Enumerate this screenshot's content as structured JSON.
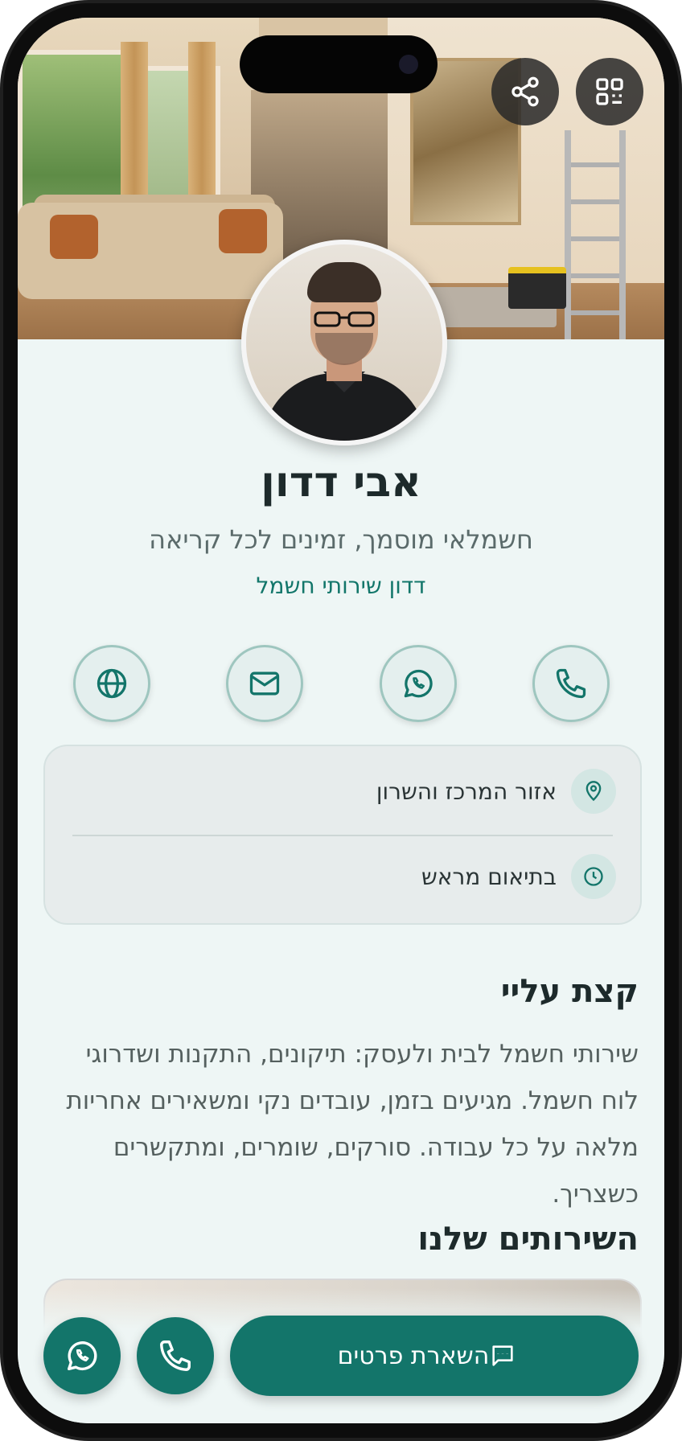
{
  "profile": {
    "name": "אבי דדון",
    "title": "חשמלאי מוסמך, זמינים לכל קריאה",
    "company": "דדון שירותי חשמל"
  },
  "info": {
    "area": "אזור המרכז והשרון",
    "hours": "בתיאום מראש"
  },
  "about": {
    "heading": "קצת עליי",
    "text": "שירותי חשמל לבית ולעסק: תיקונים, התקנות ושדרוגי לוח חשמל. מגיעים בזמן, עובדים נקי ומשאירים אחריות מלאה על כל עבודה. סורקים, שומרים, ומתקשרים כשצריך."
  },
  "services": {
    "heading": "השירותים שלנו"
  },
  "cta": {
    "label": "השארת פרטים"
  },
  "icons": {
    "share": "share-icon",
    "qr": "qr-code-icon",
    "phone": "phone-icon",
    "whatsapp": "whatsapp-icon",
    "email": "mail-icon",
    "website": "globe-icon",
    "location": "map-pin-icon",
    "clock": "clock-icon",
    "message": "message-icon"
  },
  "colors": {
    "accent": "#13756a",
    "background": "#eef6f5",
    "text": "#1d2a2b"
  }
}
